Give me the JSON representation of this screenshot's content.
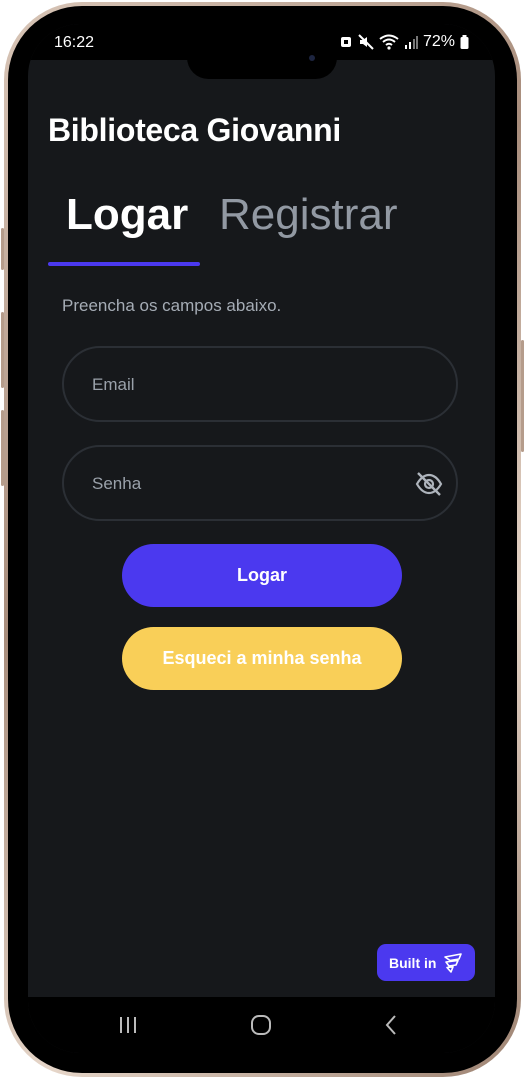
{
  "status_bar": {
    "time": "16:22",
    "battery": "72%"
  },
  "app": {
    "title": "Biblioteca Giovanni"
  },
  "tabs": [
    {
      "label": "Logar",
      "active": true
    },
    {
      "label": "Registrar",
      "active": false
    }
  ],
  "form": {
    "subtitle": "Preencha os campos abaixo.",
    "email_placeholder": "Email",
    "email_value": "",
    "password_placeholder": "Senha",
    "password_value": "",
    "login_button": "Logar",
    "forgot_button": "Esqueci a minha senha"
  },
  "badge": {
    "label": "Built in"
  },
  "colors": {
    "background": "#16181b",
    "primary": "#4b39ef",
    "secondary": "#f9cf58",
    "text_primary": "#ffffff",
    "text_secondary": "#9299a3"
  },
  "icons": {
    "password_toggle": "eye-off-icon",
    "badge_logo": "flutterflow-logo-icon",
    "nav_recent": "recent-apps-icon",
    "nav_home": "home-icon",
    "nav_back": "back-icon"
  }
}
